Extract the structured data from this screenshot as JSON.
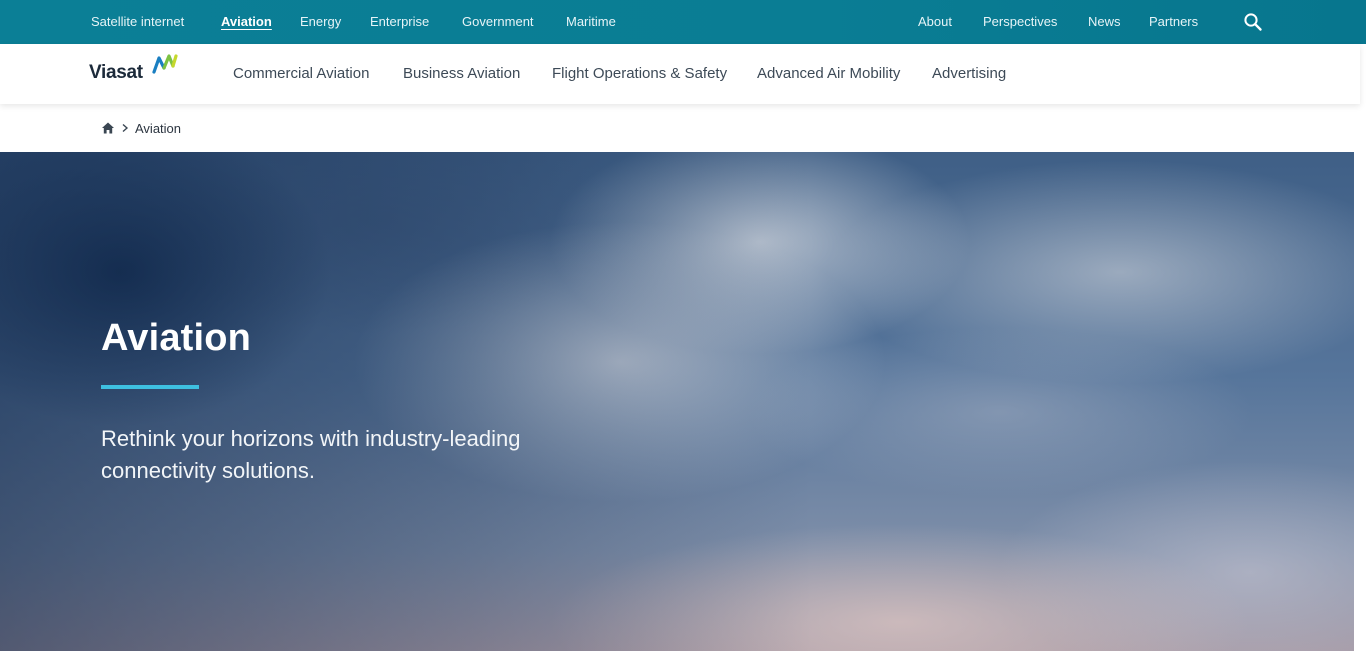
{
  "topbar": {
    "links": [
      "Satellite internet",
      "Aviation",
      "Energy",
      "Enterprise",
      "Government",
      "Maritime"
    ],
    "right_links": [
      "About",
      "Perspectives",
      "News",
      "Partners"
    ],
    "active": "Aviation",
    "search_icon": "search-icon"
  },
  "brand": {
    "name": "Viasat",
    "mark_colors": [
      "#1a7fc1",
      "#7cc242",
      "#c5d82d"
    ]
  },
  "mainnav": {
    "items": [
      "Commercial Aviation",
      "Business Aviation",
      "Flight Operations & Safety",
      "Advanced Air Mobility",
      "Advertising"
    ]
  },
  "breadcrumb": {
    "home_icon": "home-icon",
    "current": "Aviation"
  },
  "hero": {
    "title": "Aviation",
    "subtitle": "Rethink your horizons with industry-leading connectivity solutions.",
    "accent_color": "#3ec0e0"
  },
  "colors": {
    "topbar": "#0a7d94",
    "nav_text": "#3d4a57"
  }
}
